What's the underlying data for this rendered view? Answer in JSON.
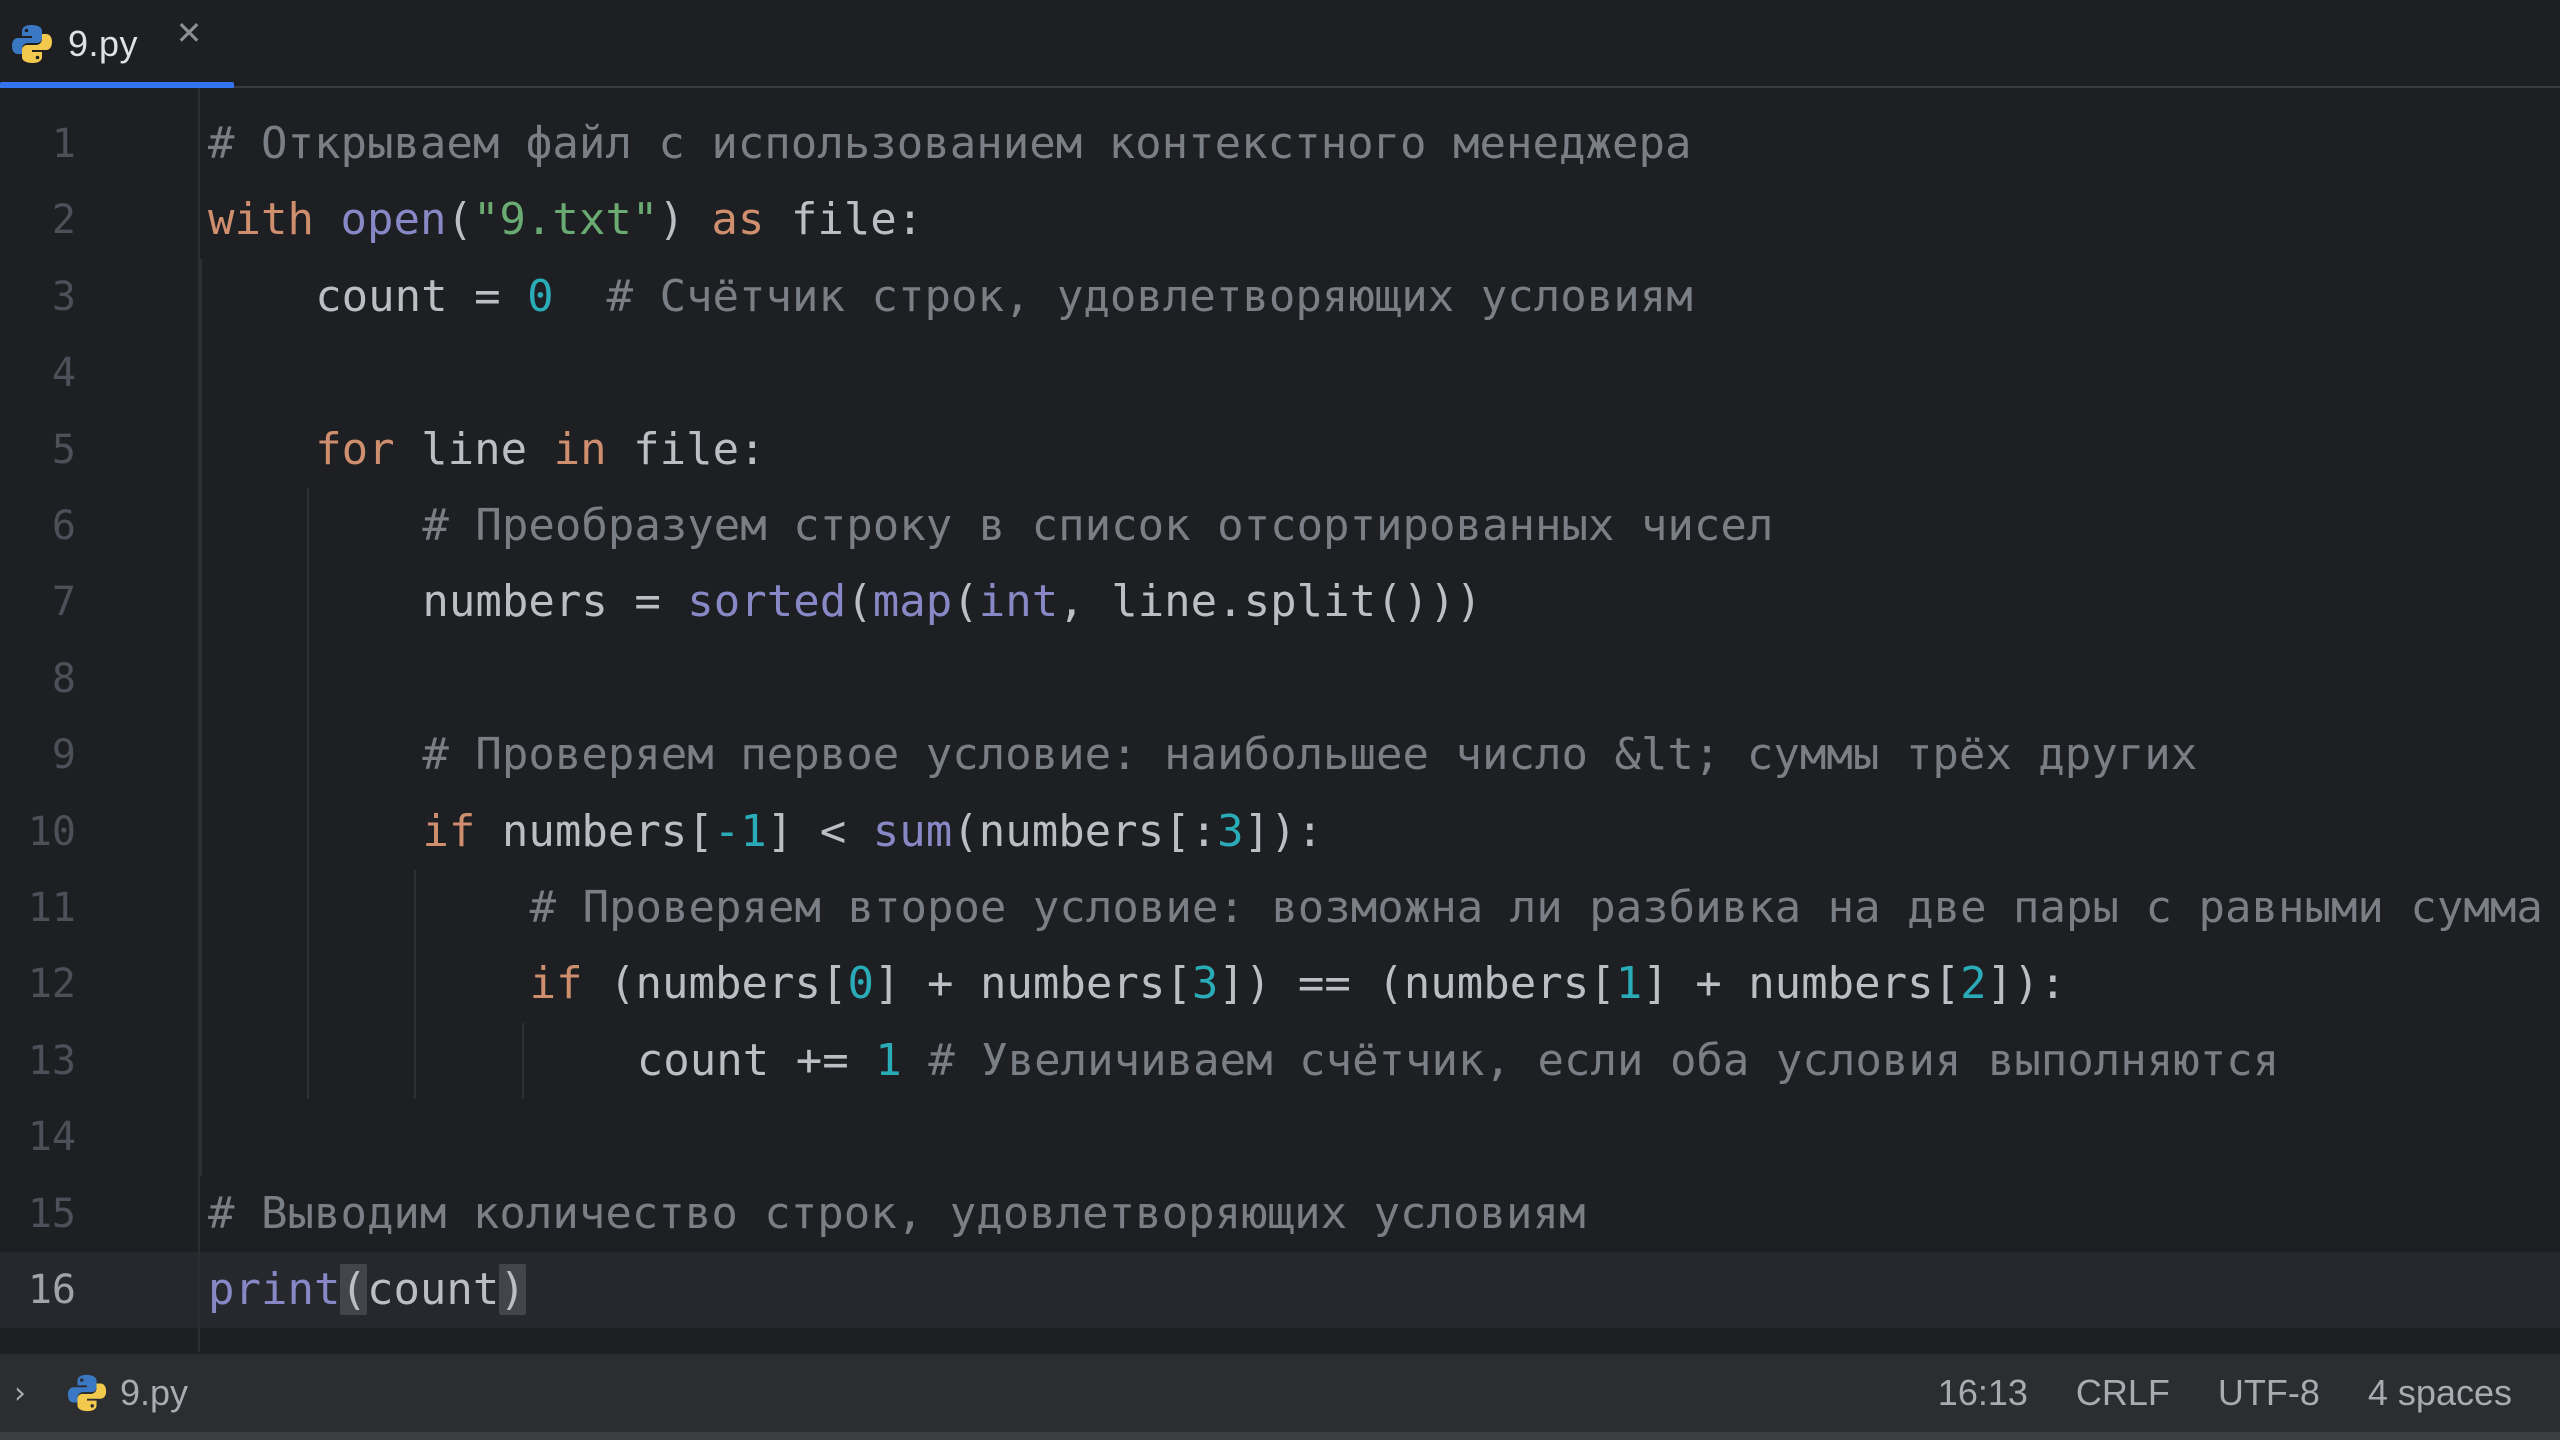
{
  "tab": {
    "title": "9.py",
    "icon": "python-icon",
    "close_symbol": "✕"
  },
  "editor": {
    "current_line": 16,
    "lines": [
      {
        "n": "1",
        "indent": 0,
        "tokens": [
          {
            "t": "# Открываем файл с использованием контекстного менеджера",
            "c": "comment"
          }
        ]
      },
      {
        "n": "2",
        "indent": 0,
        "tokens": [
          {
            "t": "with",
            "c": "kw"
          },
          {
            "t": " "
          },
          {
            "t": "open",
            "c": "builtin"
          },
          {
            "t": "("
          },
          {
            "t": "\"9.txt\"",
            "c": "string"
          },
          {
            "t": ") "
          },
          {
            "t": "as",
            "c": "kw"
          },
          {
            "t": " file:"
          }
        ]
      },
      {
        "n": "3",
        "indent": 1,
        "tokens": [
          {
            "t": "count = "
          },
          {
            "t": "0",
            "c": "number"
          },
          {
            "t": "  "
          },
          {
            "t": "# Счётчик строк, удовлетворяющих условиям",
            "c": "comment"
          }
        ]
      },
      {
        "n": "4",
        "indent": 0,
        "tokens": []
      },
      {
        "n": "5",
        "indent": 1,
        "tokens": [
          {
            "t": "for",
            "c": "kw"
          },
          {
            "t": " line "
          },
          {
            "t": "in",
            "c": "kw"
          },
          {
            "t": " file:"
          }
        ]
      },
      {
        "n": "6",
        "indent": 2,
        "tokens": [
          {
            "t": "# Преобразуем строку в список отсортированных чисел",
            "c": "comment"
          }
        ]
      },
      {
        "n": "7",
        "indent": 2,
        "tokens": [
          {
            "t": "numbers = "
          },
          {
            "t": "sorted",
            "c": "builtin"
          },
          {
            "t": "("
          },
          {
            "t": "map",
            "c": "builtin"
          },
          {
            "t": "("
          },
          {
            "t": "int",
            "c": "builtin"
          },
          {
            "t": ", line.split()))"
          }
        ]
      },
      {
        "n": "8",
        "indent": 0,
        "tokens": []
      },
      {
        "n": "9",
        "indent": 2,
        "tokens": [
          {
            "t": "# Проверяем первое условие: наибольшее число &lt; суммы трёх других",
            "c": "comment"
          }
        ]
      },
      {
        "n": "10",
        "indent": 2,
        "tokens": [
          {
            "t": "if",
            "c": "kw"
          },
          {
            "t": " numbers["
          },
          {
            "t": "-1",
            "c": "number"
          },
          {
            "t": "] < "
          },
          {
            "t": "sum",
            "c": "builtin"
          },
          {
            "t": "(numbers[:"
          },
          {
            "t": "3",
            "c": "number"
          },
          {
            "t": "]):"
          }
        ]
      },
      {
        "n": "11",
        "indent": 3,
        "tokens": [
          {
            "t": "# Проверяем второе условие: возможна ли разбивка на две пары с равными сумма",
            "c": "comment"
          }
        ]
      },
      {
        "n": "12",
        "indent": 3,
        "tokens": [
          {
            "t": "if",
            "c": "kw"
          },
          {
            "t": " (numbers["
          },
          {
            "t": "0",
            "c": "number"
          },
          {
            "t": "] + numbers["
          },
          {
            "t": "3",
            "c": "number"
          },
          {
            "t": "]) == (numbers["
          },
          {
            "t": "1",
            "c": "number"
          },
          {
            "t": "] + numbers["
          },
          {
            "t": "2",
            "c": "number"
          },
          {
            "t": "]):"
          }
        ]
      },
      {
        "n": "13",
        "indent": 4,
        "tokens": [
          {
            "t": "count += "
          },
          {
            "t": "1",
            "c": "number"
          },
          {
            "t": " "
          },
          {
            "t": "# Увеличиваем счётчик, если оба условия выполняются",
            "c": "comment"
          }
        ]
      },
      {
        "n": "14",
        "indent": 0,
        "tokens": []
      },
      {
        "n": "15",
        "indent": 0,
        "tokens": [
          {
            "t": "# Выводим количество строк, удовлетворяющих условиям",
            "c": "comment"
          }
        ]
      },
      {
        "n": "16",
        "indent": 0,
        "tokens": [
          {
            "t": "print",
            "c": "builtin"
          },
          {
            "t": "(",
            "c": "brace"
          },
          {
            "t": "count"
          },
          {
            "t": ")",
            "c": "brace"
          }
        ]
      }
    ]
  },
  "statusbar": {
    "chevron": "›",
    "file_icon": "python-icon",
    "file_name": "9.py",
    "position": "16:13",
    "line_separator": "CRLF",
    "encoding": "UTF-8",
    "indent": "4 spaces"
  },
  "colors": {
    "background": "#1e1f22",
    "comment": "#7a7e85",
    "keyword": "#cf8e6d",
    "builtin": "#8888c6",
    "string": "#6aab73",
    "number": "#2aacb8",
    "accent": "#3574f0"
  }
}
